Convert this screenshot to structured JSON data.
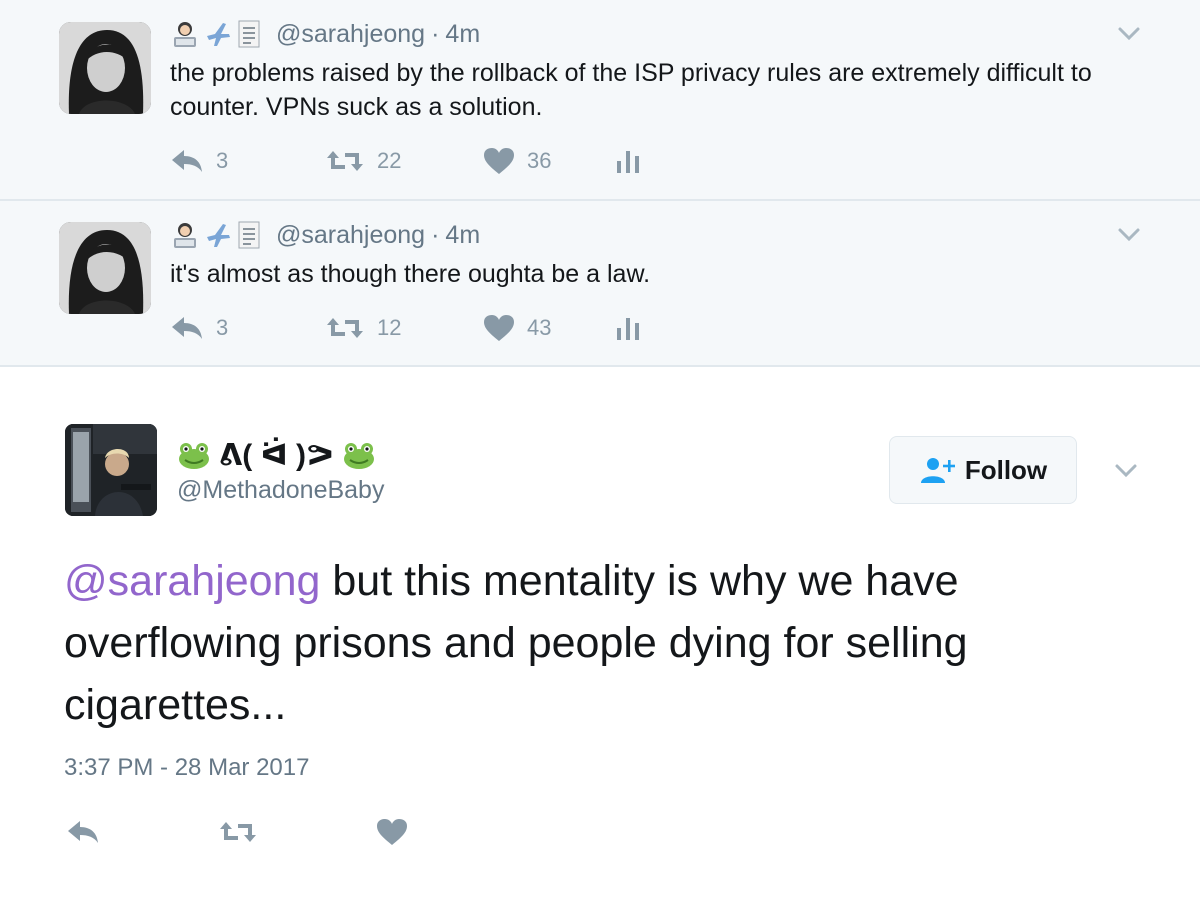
{
  "replies": [
    {
      "handle": "@sarahjeong",
      "separator": "·",
      "time": "4m",
      "text": "the problems raised by the rollback of the ISP privacy rules are extremely difficult to counter. VPNs suck as a solution.",
      "reply_count": "3",
      "retweet_count": "22",
      "like_count": "36"
    },
    {
      "handle": "@sarahjeong",
      "separator": "·",
      "time": "4m",
      "text": "it's almost as though there oughta be a law.",
      "reply_count": "3",
      "retweet_count": "12",
      "like_count": "43"
    }
  ],
  "main_tweet": {
    "display_name_core": "ᕕ( ᐛ )ᕗ",
    "handle": "@MethadoneBaby",
    "follow_label": "Follow",
    "mention": "@sarahjeong",
    "text_rest": " but this mentality is why we have overflowing prisons and people dying for selling cigarettes...",
    "timestamp": "3:37 PM - 28 Mar 2017"
  },
  "icons": {
    "reply": "reply-arrow-icon",
    "retweet": "retweet-icon",
    "like": "heart-icon",
    "analytics": "analytics-bars-icon",
    "caret": "chevron-down-icon",
    "follow": "follow-person-plus-icon",
    "name_emoji": "frog-emoji-icon"
  },
  "colors": {
    "reply_bg": "#f5f8fa",
    "divider": "#e1e8ed",
    "mention": "#9266cc",
    "icon_gray": "#8899a6",
    "follow_icon": "#1da1f2"
  }
}
